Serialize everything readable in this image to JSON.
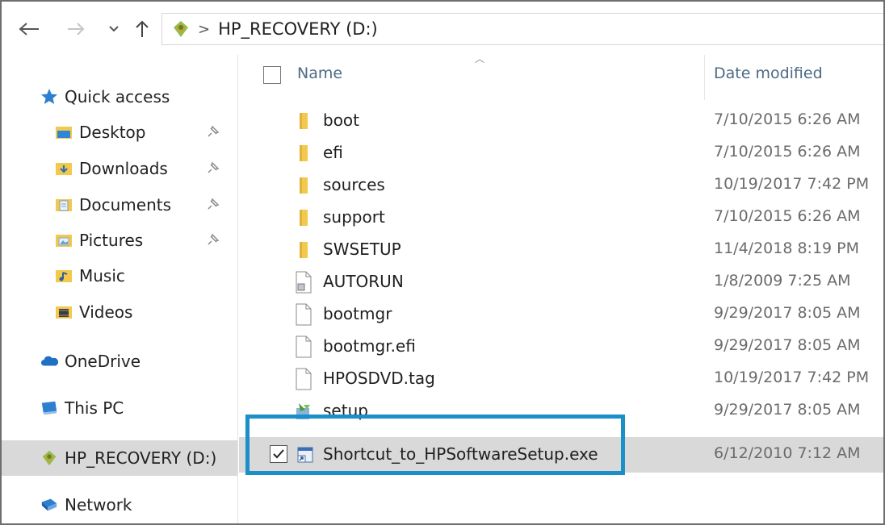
{
  "nav": {
    "back_icon": "back-arrow-icon",
    "forward_icon": "forward-arrow-icon",
    "recent_icon": "chevron-down-icon",
    "up_icon": "up-arrow-icon"
  },
  "address": {
    "drive_icon": "recovery-drive-icon",
    "separator": ">",
    "path": "HP_RECOVERY (D:)"
  },
  "sidebar": {
    "quick_access": "Quick access",
    "pinned": [
      {
        "label": "Desktop",
        "icon": "desktop-folder-icon"
      },
      {
        "label": "Downloads",
        "icon": "downloads-folder-icon"
      },
      {
        "label": "Documents",
        "icon": "documents-folder-icon"
      },
      {
        "label": "Pictures",
        "icon": "pictures-folder-icon"
      }
    ],
    "music": "Music",
    "videos": "Videos",
    "onedrive": "OneDrive",
    "this_pc": "This PC",
    "recovery": "HP_RECOVERY (D:)",
    "network": "Network"
  },
  "columns": {
    "name": "Name",
    "date_modified": "Date modified"
  },
  "files": [
    {
      "name": "boot",
      "date": "7/10/2015 6:26 AM",
      "icon": "folder-icon"
    },
    {
      "name": "efi",
      "date": "7/10/2015 6:26 AM",
      "icon": "folder-icon"
    },
    {
      "name": "sources",
      "date": "10/19/2017 7:42 PM",
      "icon": "folder-icon"
    },
    {
      "name": "support",
      "date": "7/10/2015 6:26 AM",
      "icon": "folder-icon"
    },
    {
      "name": "SWSETUP",
      "date": "11/4/2018 8:19 PM",
      "icon": "folder-icon"
    },
    {
      "name": "AUTORUN",
      "date": "1/8/2009 7:25 AM",
      "icon": "setup-info-file-icon"
    },
    {
      "name": "bootmgr",
      "date": "9/29/2017 8:05 AM",
      "icon": "file-icon"
    },
    {
      "name": "bootmgr.efi",
      "date": "9/29/2017 8:05 AM",
      "icon": "file-icon"
    },
    {
      "name": "HPOSDVD.tag",
      "date": "10/19/2017 7:42 PM",
      "icon": "file-icon"
    },
    {
      "name": "setup",
      "date": "9/29/2017 8:05 AM",
      "icon": "setup-app-icon"
    },
    {
      "name": "Shortcut_to_HPSoftwareSetup.exe",
      "date": "6/12/2010 7:12 AM",
      "icon": "shortcut-app-icon",
      "selected": true
    }
  ],
  "colors": {
    "highlight": "#1b8fc7",
    "selection": "#d9d9d9",
    "folder": "#f2c94c",
    "column_header": "#4d6a86"
  }
}
